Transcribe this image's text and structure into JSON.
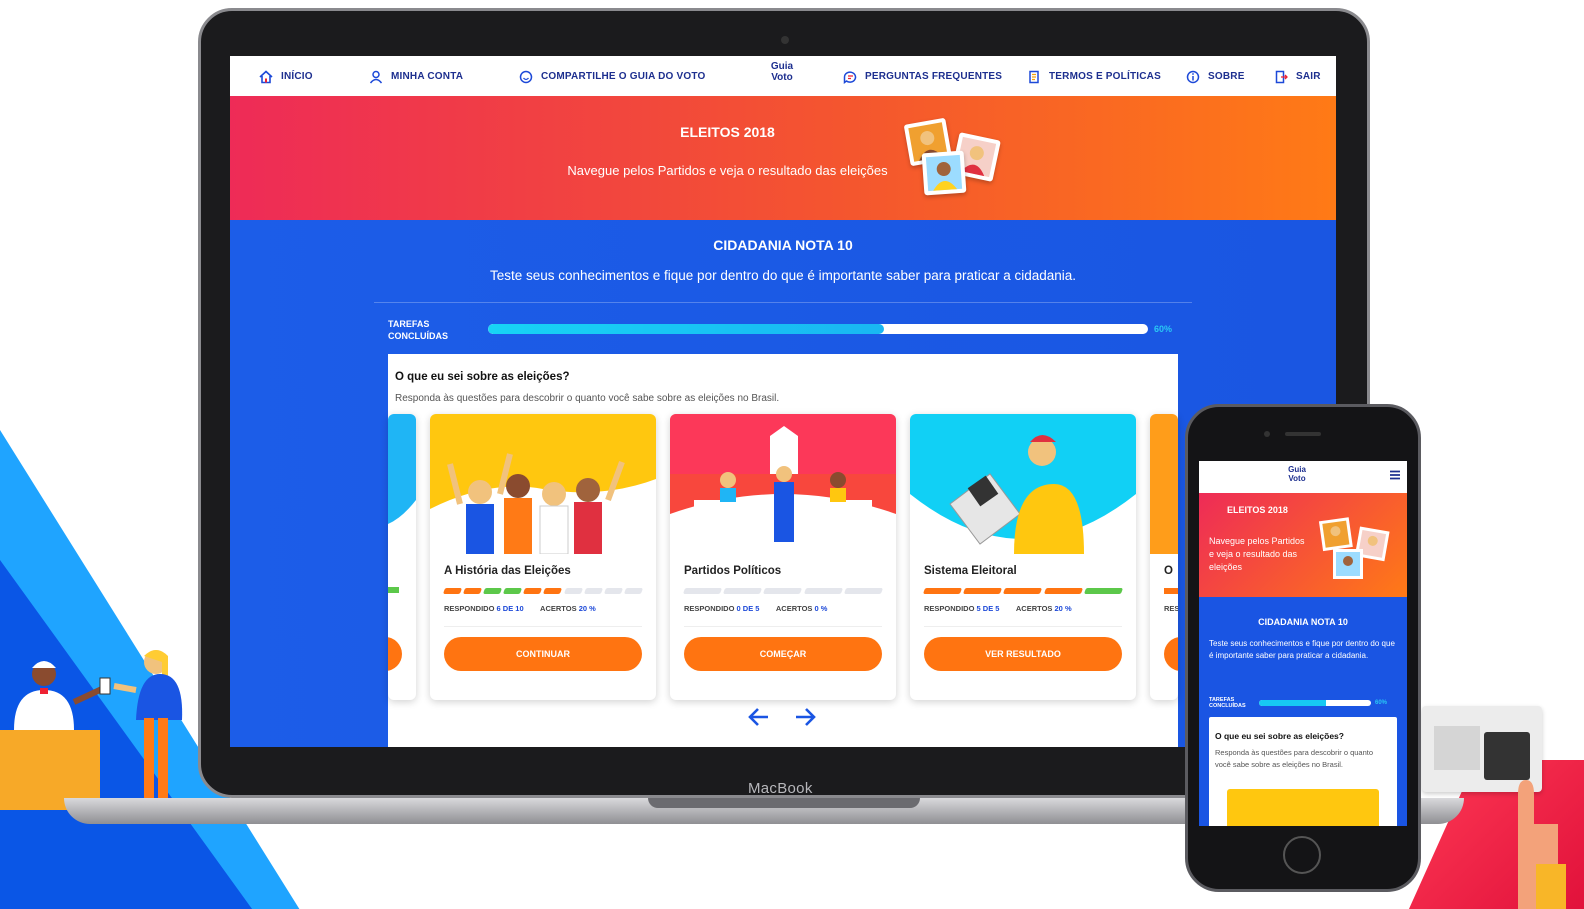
{
  "laptop": {
    "brand_label": "MacBook",
    "nav": {
      "inicio": "INÍCIO",
      "minha_conta": "MINHA CONTA",
      "compartilhe": "COMPARTILHE O GUIA DO VOTO",
      "logo_line1": "Guia",
      "logo_line2": "Voto",
      "perguntas": "PERGUNTAS FREQUENTES",
      "termos": "TERMOS E POLÍTICAS",
      "sobre": "SOBRE",
      "sair": "SAIR"
    },
    "hero": {
      "title": "ELEITOS 2018",
      "subtitle": "Navegue pelos Partidos e veja o resultado das eleições"
    },
    "section": {
      "title": "CIDADANIA NOTA 10",
      "subtitle": "Teste seus conhecimentos e fique por dentro do que é importante saber para praticar a cidadania."
    },
    "progress": {
      "label_line1": "TAREFAS",
      "label_line2": "CONCLUÍDAS",
      "value": 0.6,
      "percent_text": "60%"
    },
    "quiz": {
      "title": "O que eu sei sobre as eleições?",
      "subtitle": "Responda às questões para descobrir o quanto você sabe sobre as eleições no Brasil."
    },
    "cards": [
      {
        "name": "A História das Eleições",
        "answered_label": "RESPONDIDO",
        "answered_value": "6 DE 10",
        "hits_label": "ACERTOS",
        "hits_value": "20 %",
        "segments": [
          "orange",
          "orange",
          "green",
          "green",
          "orange",
          "orange",
          "empty",
          "empty",
          "empty",
          "empty"
        ],
        "button": "CONTINUAR"
      },
      {
        "name": "Partidos Políticos",
        "answered_label": "RESPONDIDO",
        "answered_value": "0 DE 5",
        "hits_label": "ACERTOS",
        "hits_value": "0 %",
        "segments": [
          "empty",
          "empty",
          "empty",
          "empty",
          "empty"
        ],
        "button": "COMEÇAR"
      },
      {
        "name": "Sistema Eleitoral",
        "answered_label": "RESPONDIDO",
        "answered_value": "5 DE 5",
        "hits_label": "ACERTOS",
        "hits_value": "20 %",
        "segments": [
          "orange",
          "orange",
          "orange",
          "orange",
          "green"
        ],
        "button": "VER RESULTADO"
      }
    ],
    "peek_right_letter": "O",
    "peek_right_stats": "RES",
    "colors": {
      "primary_blue": "#1a55e3",
      "orange": "#ff7411",
      "green": "#5cc84a",
      "nav_text": "#1d2f8f"
    }
  },
  "phone": {
    "logo_line1": "Guia",
    "logo_line2": "Voto",
    "menu_icon": "hamburger-icon",
    "hero_title": "ELEITOS 2018",
    "hero_subtitle": "Navegue pelos Partidos e veja o resultado das eleições",
    "section_title": "CIDADANIA NOTA 10",
    "section_subtitle": "Teste seus conhecimentos e fique por dentro do que é importante saber para praticar a cidadania.",
    "progress_label_line1": "TAREFAS",
    "progress_label_line2": "CONCLUÍDAS",
    "progress_value": 0.6,
    "progress_text": "60%",
    "quiz_title": "O que eu sei sobre as eleições?",
    "quiz_subtitle": "Responda às questões para descobrir o quanto você sabe sobre as eleições no Brasil."
  }
}
